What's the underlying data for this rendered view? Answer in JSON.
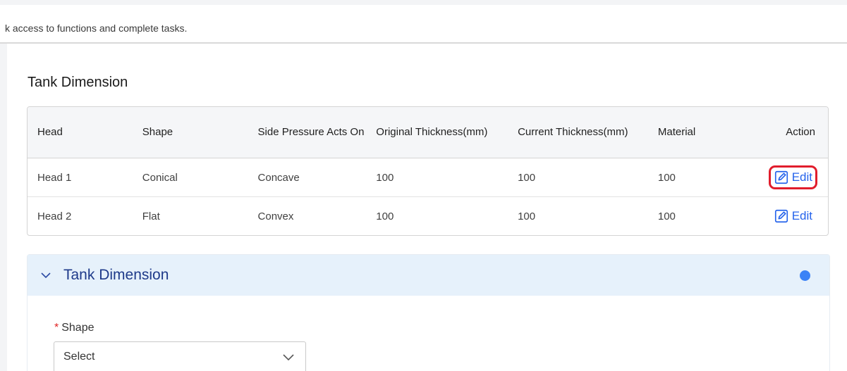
{
  "banner": {
    "text": "k access to functions and complete tasks."
  },
  "section": {
    "title": "Tank Dimension"
  },
  "table": {
    "headers": {
      "head": "Head",
      "shape": "Shape",
      "side_pressure": "Side Pressure Acts On",
      "original_thickness": "Original Thickness(mm)",
      "current_thickness": "Current Thickness(mm)",
      "material": "Material",
      "action": "Action"
    },
    "rows": [
      {
        "head": "Head 1",
        "shape": "Conical",
        "side_pressure": "Concave",
        "original_thickness": "100",
        "current_thickness": "100",
        "material": "100",
        "action_label": "Edit"
      },
      {
        "head": "Head 2",
        "shape": "Flat",
        "side_pressure": "Convex",
        "original_thickness": "100",
        "current_thickness": "100",
        "material": "100",
        "action_label": "Edit"
      }
    ]
  },
  "panel": {
    "title": "Tank Dimension",
    "status_color": "#3b82f6",
    "field_label": "Shape",
    "required_mark": "*",
    "select_value": "Select"
  },
  "colors": {
    "accent": "#2563eb",
    "highlight": "#e11d2c",
    "panel_header_bg": "#e6f1fb"
  }
}
